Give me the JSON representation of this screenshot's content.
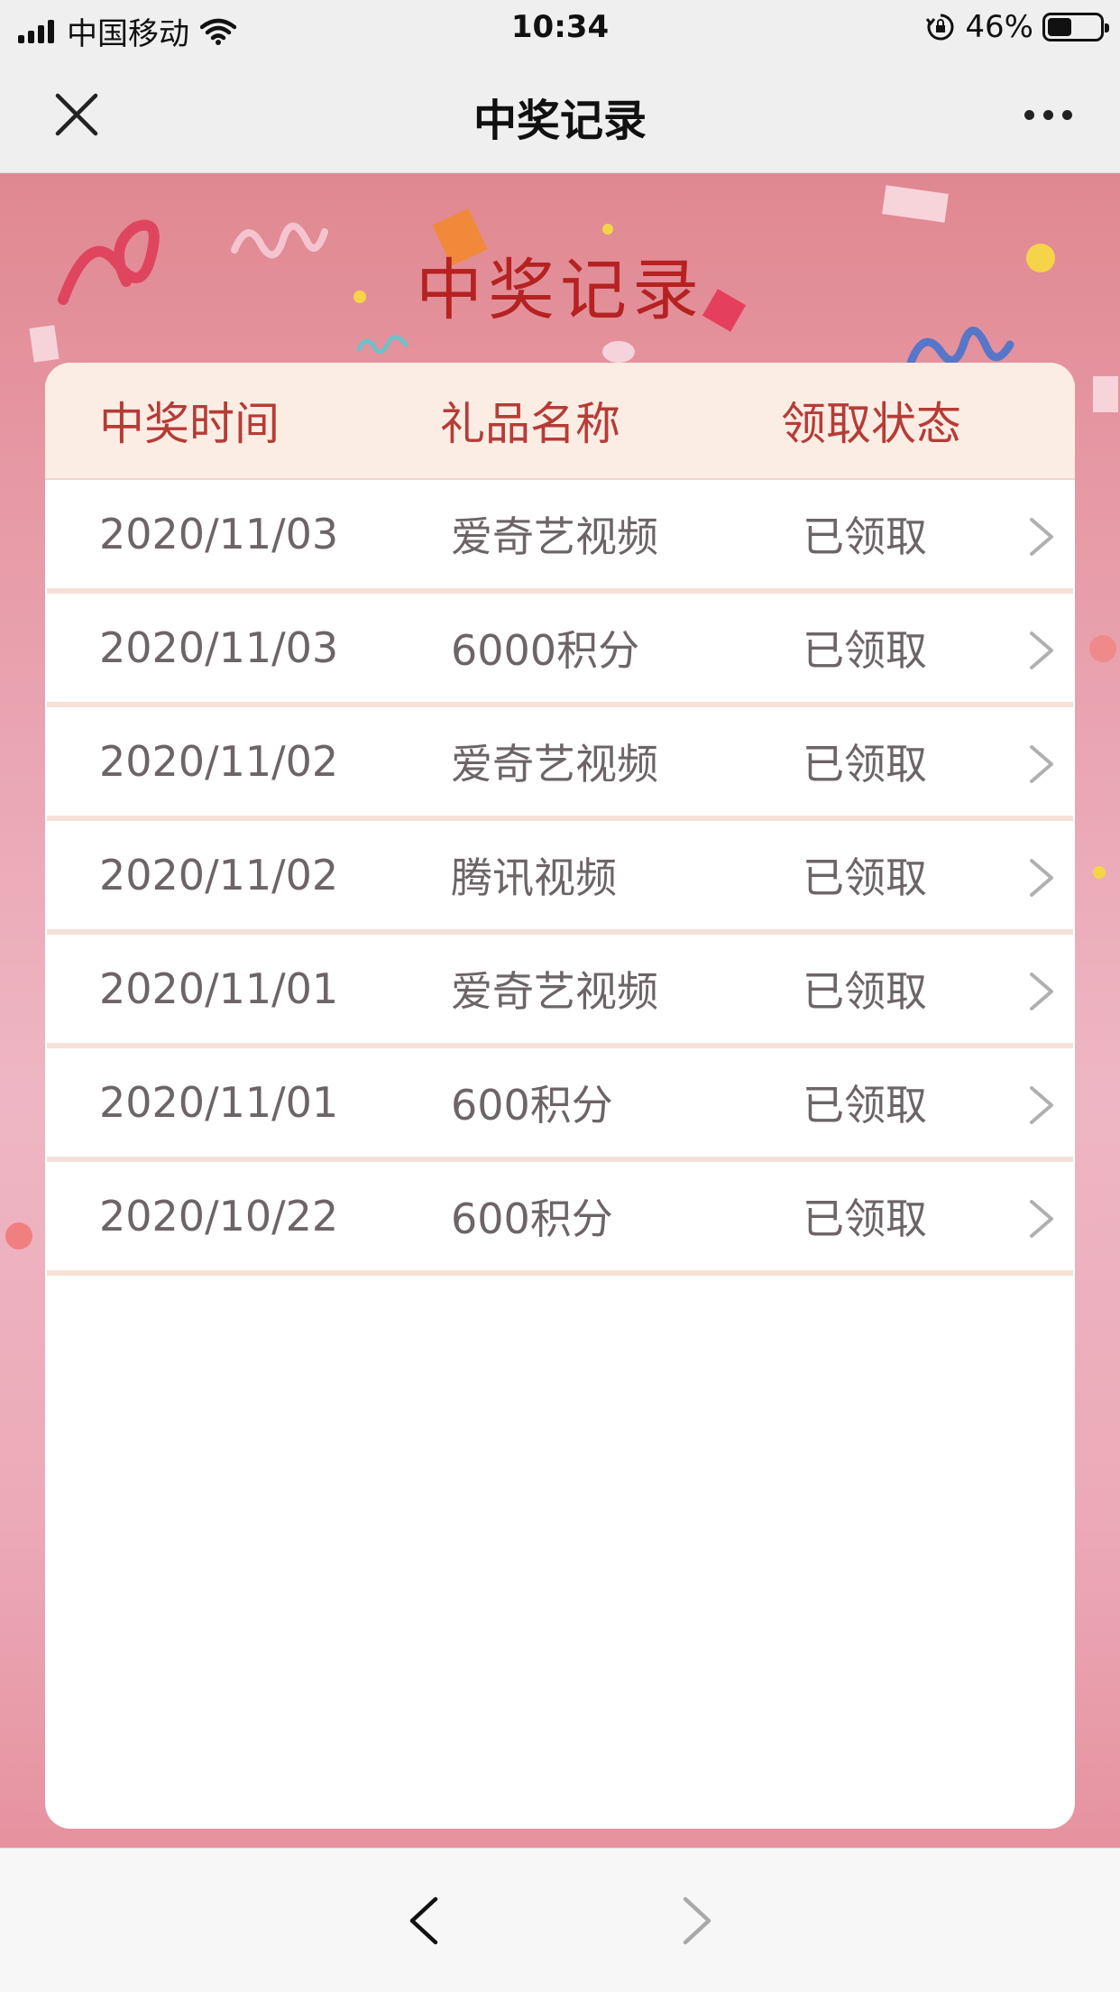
{
  "status_bar": {
    "carrier": "中国移动",
    "time": "10:34",
    "battery_percent": "46%",
    "battery_level": 0.46,
    "icons": [
      "signal-icon",
      "wifi-icon",
      "rotation-lock-icon",
      "battery-icon"
    ]
  },
  "nav": {
    "title": "中奖记录",
    "close_icon": "close-icon",
    "more_icon": "more-icon"
  },
  "banner": {
    "title": "中奖记录"
  },
  "table": {
    "headers": {
      "time": "中奖时间",
      "gift": "礼品名称",
      "status": "领取状态"
    },
    "rows": [
      {
        "time": "2020/11/03",
        "gift": "爱奇艺视频",
        "status": "已领取"
      },
      {
        "time": "2020/11/03",
        "gift": "6000积分",
        "status": "已领取"
      },
      {
        "time": "2020/11/02",
        "gift": "爱奇艺视频",
        "status": "已领取"
      },
      {
        "time": "2020/11/02",
        "gift": "腾讯视频",
        "status": "已领取"
      },
      {
        "time": "2020/11/01",
        "gift": "爱奇艺视频",
        "status": "已领取"
      },
      {
        "time": "2020/11/01",
        "gift": "600积分",
        "status": "已领取"
      },
      {
        "time": "2020/10/22",
        "gift": "600积分",
        "status": "已领取"
      }
    ]
  },
  "bottom_bar": {
    "back_icon": "back-arrow-icon",
    "forward_icon": "forward-arrow-icon"
  },
  "colors": {
    "title_red": "#b52221",
    "header_bg": "#fbede4",
    "header_text": "#b73b36",
    "cell_text": "#6c6467",
    "row_divider": "#f5e1d7"
  }
}
